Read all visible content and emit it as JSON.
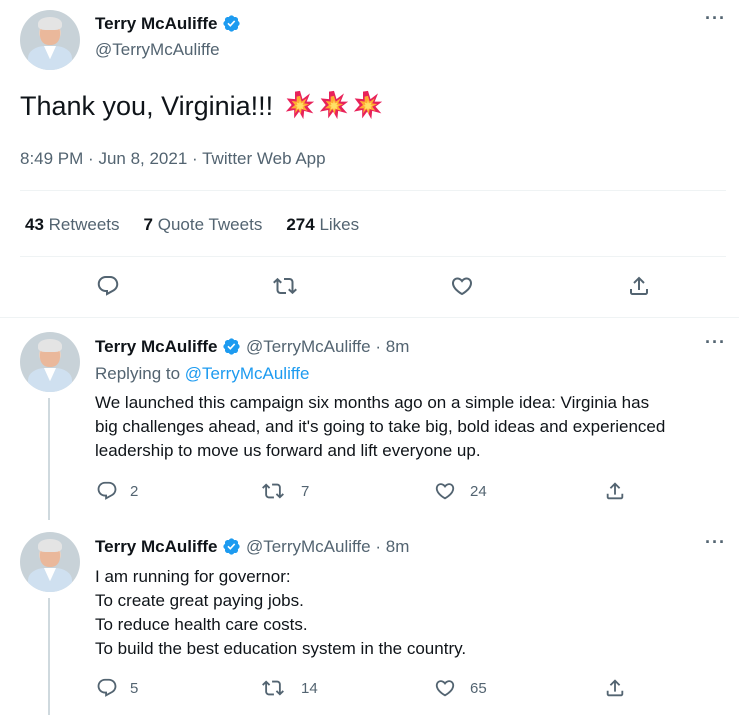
{
  "main_tweet": {
    "author_name": "Terry McAuliffe",
    "author_handle": "@TerryMcAuliffe",
    "text": "Thank you, Virginia!!!",
    "emoji_icons": [
      "collision-icon",
      "collision-icon",
      "collision-icon"
    ],
    "timestamp": "8:49 PM",
    "date": "Jun 8, 2021",
    "source": "Twitter Web App",
    "stats": {
      "retweets_count": "43",
      "retweets_label": "Retweets",
      "quote_count": "7",
      "quote_label": "Quote Tweets",
      "likes_count": "274",
      "likes_label": "Likes"
    }
  },
  "replies": [
    {
      "author_name": "Terry McAuliffe",
      "author_handle": "@TerryMcAuliffe",
      "time": "8m",
      "replying_label": "Replying to",
      "replying_to": "@TerryMcAuliffe",
      "text_lines": [
        "We launched this campaign six months ago on a simple idea: Virginia has",
        "big challenges ahead, and it's going to take big, bold ideas and experienced",
        "leadership to move us forward and lift everyone up."
      ],
      "reply_count": "2",
      "retweet_count": "7",
      "like_count": "24"
    },
    {
      "author_name": "Terry McAuliffe",
      "author_handle": "@TerryMcAuliffe",
      "time": "8m",
      "text_lines": [
        "I am running for governor:",
        "To create great paying jobs.",
        "To reduce health care costs.",
        "To build the best education system in the country."
      ],
      "reply_count": "5",
      "retweet_count": "14",
      "like_count": "65"
    }
  ],
  "colors": {
    "accent": "#1d9bf0",
    "muted": "#536471",
    "text": "#0f1419",
    "divider": "#eff3f4"
  }
}
